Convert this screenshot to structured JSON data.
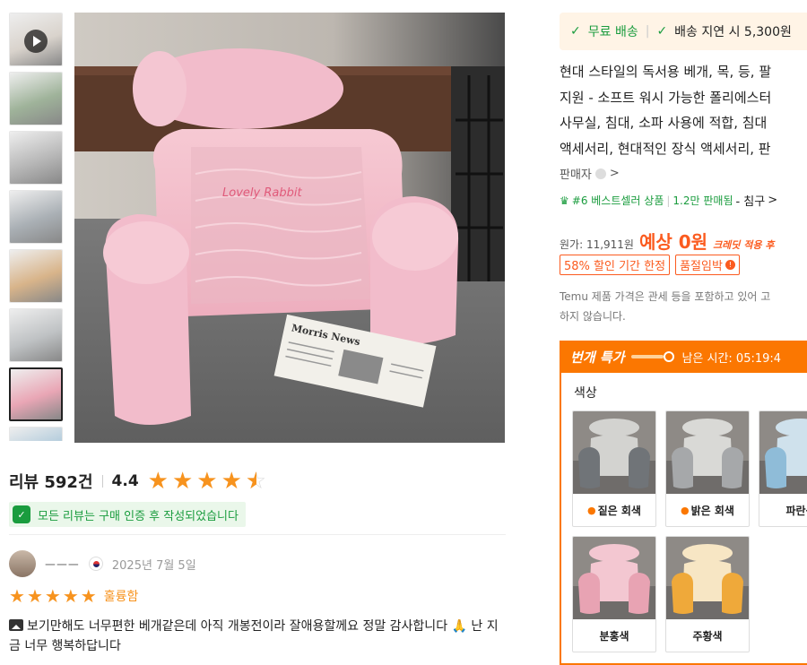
{
  "gallery": {
    "thumbnails": [
      {
        "name": "video",
        "color": "#d9d3cc"
      },
      {
        "name": "lifestyle-green",
        "color": "#9fb39a"
      },
      {
        "name": "size-chart",
        "color": "#b8b8b8"
      },
      {
        "name": "grey-bedroom",
        "color": "#aab0b5"
      },
      {
        "name": "color-variants",
        "color": "#d8b48a"
      },
      {
        "name": "grey-sofa",
        "color": "#bfc2c4"
      },
      {
        "name": "pink-active",
        "color": "#e9a6b5"
      },
      {
        "name": "blue-partial",
        "color": "#a9c6d9"
      }
    ],
    "main_image": {
      "logo_text": "Lovely Rabbit",
      "newspaper_title": "Morris News"
    }
  },
  "reviews": {
    "title": "리뷰 592건",
    "rating": "4.4",
    "verified_text": "모든 리뷰는 구매 인증 후 작성되었습니다",
    "item": {
      "name": "ㅡㅡㅡ",
      "date": "2025년 7월 5일",
      "grade": "훌륭함",
      "text": "보기만해도 너무편한 베개같은데 아직 개봉전이라 잘애용할께요 정말 감사합니다 🙏 난 지금 너무 행복하답니다"
    }
  },
  "shipping": {
    "free_label": "무료 배송",
    "delay_label": "배송 지연 시 5,300원"
  },
  "product": {
    "title_lines": [
      "현대 스타일의 독서용 베개, 목, 등, 팔",
      "지원 - 소프트 워시 가능한 폴리에스터",
      "사무실, 침대, 소파 사용에 적합, 침대",
      "액세서리, 현대적인 장식 액세서리, 판"
    ],
    "seller_label": "판매자",
    "seller_arrow": ">",
    "bestseller": {
      "rank": "#6 베스트셀러 상품",
      "sold": "1.2만 판매됨",
      "category": "- 침구",
      "arrow": ">"
    }
  },
  "price": {
    "original": "원가: 11,911원",
    "expected": "예상 0원",
    "credit": "크레딧 적용 후",
    "tag_discount": "58% 할인 기간 한정",
    "tag_soldout": "품절임박"
  },
  "notice": {
    "line1": "Temu 제품 가격은 관세 등을 포함하고 있어 고",
    "line2": "하지 않습니다."
  },
  "flash_sale": {
    "title": "번개 특가",
    "timer": "남은 시간: 05:19:4",
    "color_label": "색상",
    "colors": [
      {
        "label": "짙은 회색",
        "hot": true,
        "body": "#d3d3d0",
        "arm": "#707478"
      },
      {
        "label": "밝은 회색",
        "hot": true,
        "body": "#d9d9d6",
        "arm": "#a6a8aa"
      },
      {
        "label": "파란색",
        "hot": false,
        "body": "#cfe1ec",
        "arm": "#8fbcd8"
      },
      {
        "label": "분홍색",
        "hot": false,
        "body": "#f3c7d1",
        "arm": "#e8a3b3"
      },
      {
        "label": "주황색",
        "hot": false,
        "body": "#f7e6c4",
        "arm": "#efa93a"
      }
    ]
  },
  "colors": {
    "accent_orange": "#fb7701",
    "price_orange": "#fb5b1f",
    "star": "#f7931e",
    "green": "#1a9c3e"
  }
}
